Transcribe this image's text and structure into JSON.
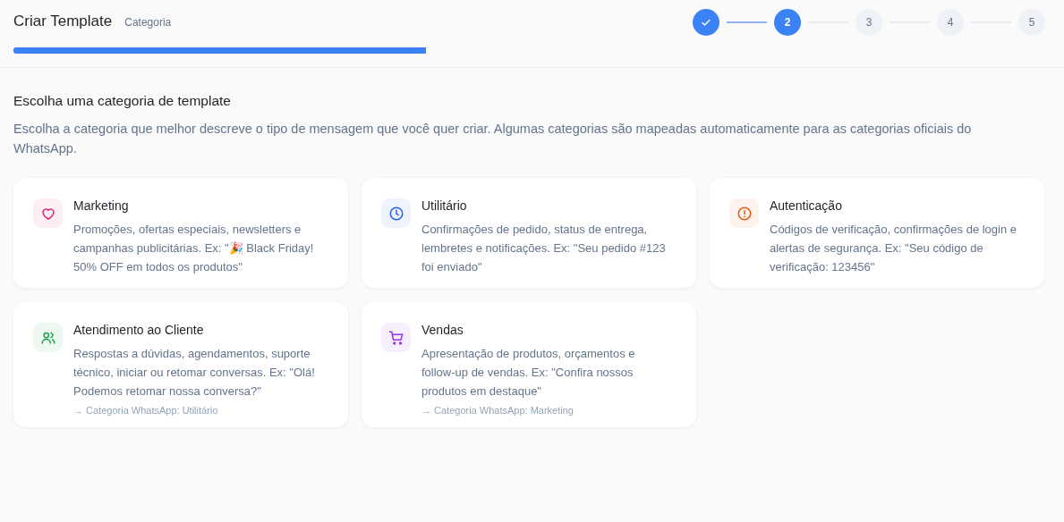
{
  "header": {
    "title": "Criar Template",
    "subtitle": "Categoria"
  },
  "steps": [
    {
      "kind": "done"
    },
    {
      "label": "2",
      "kind": "current"
    },
    {
      "label": "3",
      "kind": "pending"
    },
    {
      "label": "4",
      "kind": "pending"
    },
    {
      "label": "5",
      "kind": "pending"
    }
  ],
  "section": {
    "title": "Escolha uma categoria de template",
    "description": "Escolha a categoria que melhor descreve o tipo de mensagem que você quer criar. Algumas categorias são mapeadas automaticamente para as categorias oficiais do WhatsApp."
  },
  "categories": [
    {
      "title": "Marketing",
      "description": "Promoções, ofertas especiais, newsletters e campanhas publicitárias. Ex: \"🎉 Black Friday! 50% OFF em todos os produtos\"",
      "color": "#db2777"
    },
    {
      "title": "Utilitário",
      "description": "Confirmações de pedido, status de entrega, lembretes e notificações. Ex: \"Seu pedido #123 foi enviado\"",
      "color": "#2563eb"
    },
    {
      "title": "Autenticação",
      "description": "Códigos de verificação, confirmações de login e alertas de segurança. Ex: \"Seu código de verificação: 123456\"",
      "color": "#ea580c"
    },
    {
      "title": "Atendimento ao Cliente",
      "description": "Respostas a dúvidas, agendamentos, suporte técnico, iniciar ou retomar conversas. Ex: \"Olá! Podemos retomar nossa conversa?\"",
      "mapping": "→ Categoria WhatsApp: Utilitário",
      "color": "#16a34a"
    },
    {
      "title": "Vendas",
      "description": "Apresentação de produtos, orçamentos e follow-up de vendas. Ex: \"Confira nossos produtos em destaque\"",
      "mapping": "→ Categoria WhatsApp: Marketing",
      "color": "#9333ea"
    }
  ]
}
